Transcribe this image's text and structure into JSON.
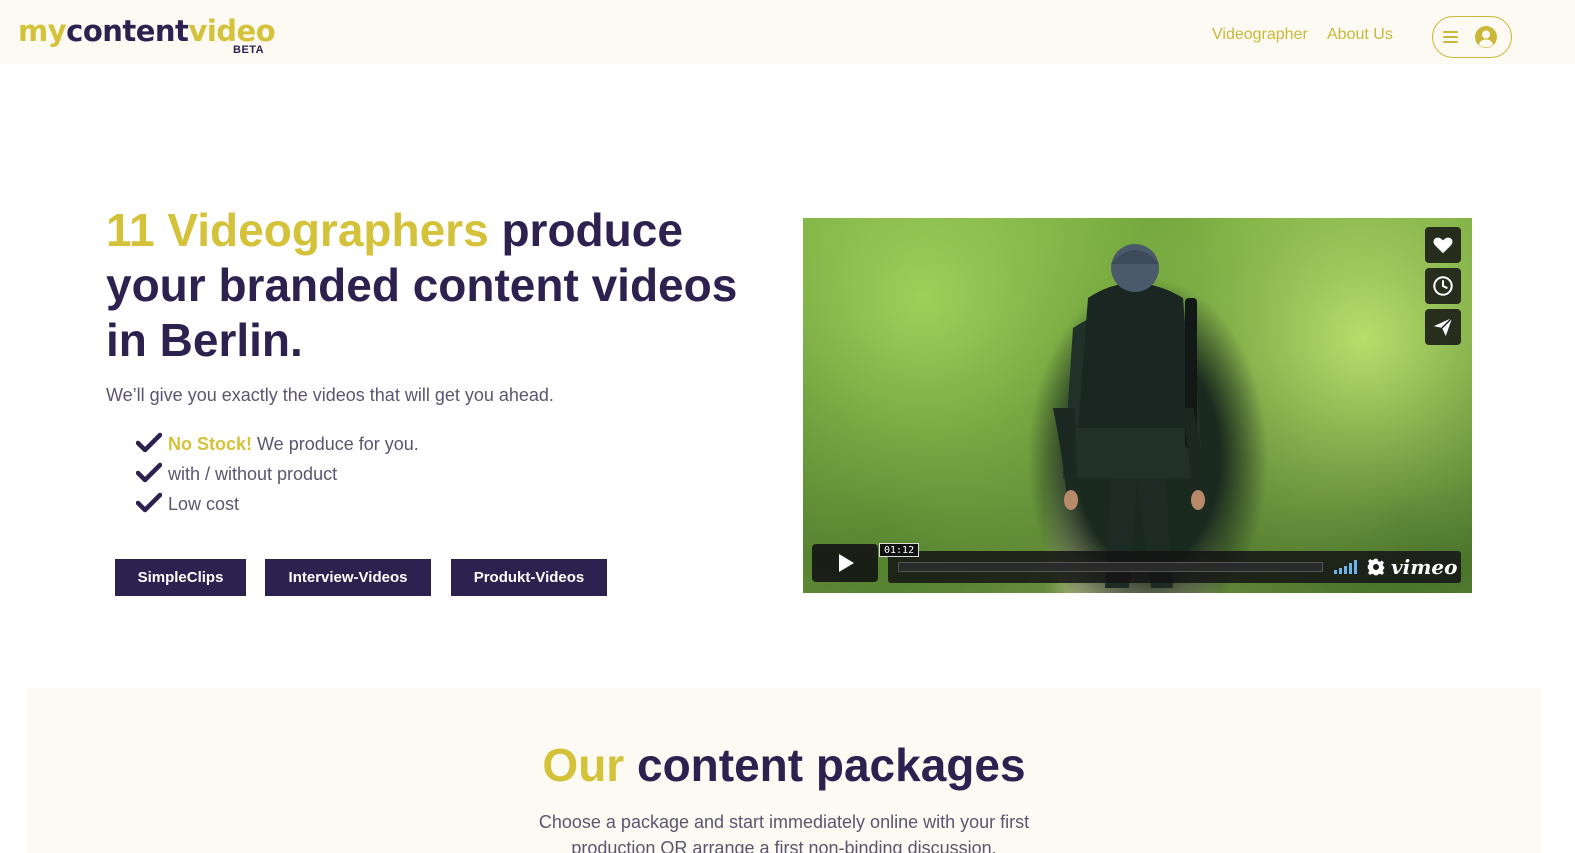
{
  "header": {
    "logo": {
      "part1": "my",
      "part2": "content",
      "part3": "video",
      "badge": "BETA"
    },
    "nav": [
      {
        "label": "Videographer"
      },
      {
        "label": "About Us"
      }
    ],
    "menu_icon": "hamburger-icon",
    "user_icon": "user-circle-icon"
  },
  "hero": {
    "title_accent": "11 Videographers",
    "title_rest": " produce your branded content videos in Berlin.",
    "subtitle": "We’ll give you exactly the videos that will get you ahead.",
    "checks": [
      {
        "highlight": "No Stock!",
        "text": " We produce for you."
      },
      {
        "highlight": "",
        "text": "with / without product"
      },
      {
        "highlight": "",
        "text": "Low cost"
      }
    ],
    "buttons": [
      {
        "label": "SimpleClips"
      },
      {
        "label": "Interview-Videos"
      },
      {
        "label": "Produkt-Videos"
      }
    ]
  },
  "video": {
    "time": "01:12",
    "brand": "vimeo",
    "side_icons": [
      "heart-icon",
      "clock-icon",
      "paper-plane-icon"
    ]
  },
  "packages": {
    "title_accent": "Our",
    "title_rest": " content packages",
    "text": "Choose a package and start immediately online with your first production OR arrange a first non-binding discussion."
  },
  "colors": {
    "accent": "#d4c23a",
    "primary": "#2d2150",
    "header_bg": "#fdfaf3"
  }
}
